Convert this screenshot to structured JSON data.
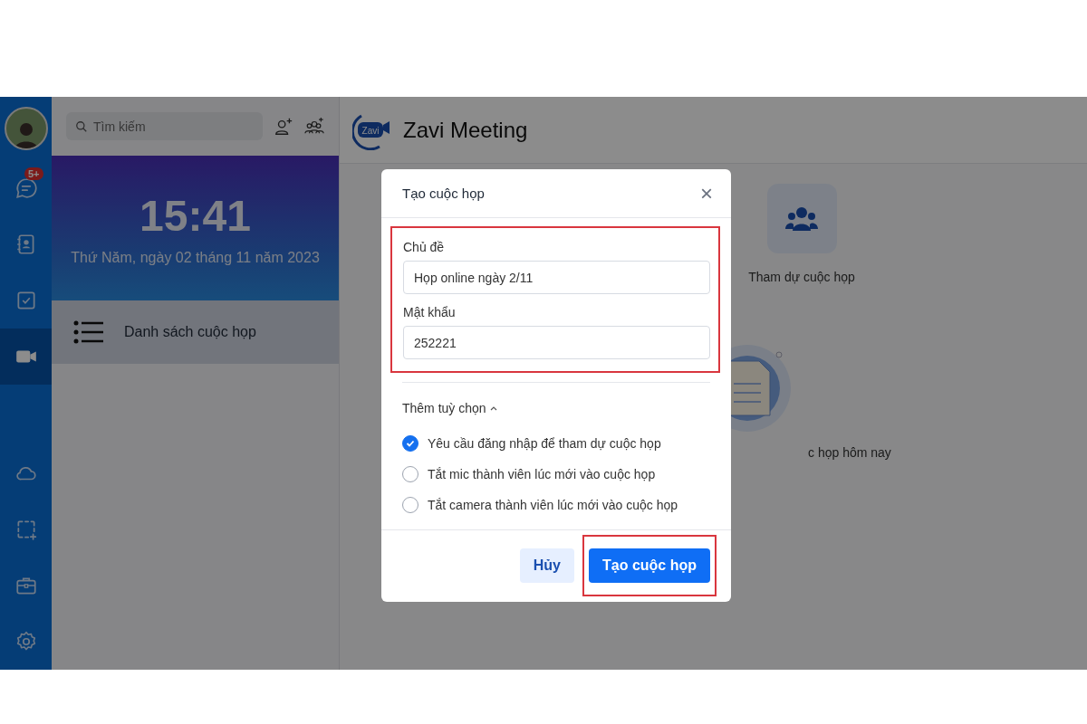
{
  "rail": [
    {
      "kind": "avatar",
      "selected": false
    },
    {
      "kind": "chat",
      "selected": false,
      "badge": "5+"
    },
    {
      "kind": "contacts",
      "selected": false
    },
    {
      "kind": "tasks",
      "selected": false
    },
    {
      "kind": "video",
      "selected": true
    },
    {
      "kind": "cloud",
      "selected": false
    },
    {
      "kind": "capture",
      "selected": false
    },
    {
      "kind": "briefcase",
      "selected": false
    },
    {
      "kind": "settings",
      "selected": false
    }
  ],
  "side": {
    "search": {
      "placeholder": "Tìm kiếm"
    },
    "clock": {
      "time": "15:41",
      "date": "Thứ Năm, ngày 02 tháng 11 năm 2023"
    },
    "items": [
      {
        "label": "Danh sách cuộc họp",
        "selected": true
      }
    ]
  },
  "main": {
    "logo_text": "Zavi",
    "title": "Zavi Meeting",
    "tiles": [
      {
        "label": "Tham dự cuộc họp"
      }
    ],
    "today_label": "c họp hôm nay"
  },
  "dialog": {
    "title": "Tạo cuộc họp",
    "close": "×",
    "fields": [
      {
        "label": "Chủ đề",
        "value": "Họp online ngày 2/11"
      },
      {
        "label": "Mật khẩu",
        "value": "252221"
      }
    ],
    "more_options": {
      "label": "Thêm tuỳ chọn",
      "expanded": true
    },
    "options": [
      {
        "label": "Yêu cầu đăng nhập để tham dự cuộc họp",
        "checked": true
      },
      {
        "label": "Tắt mic thành viên lúc mới vào cuộc họp",
        "checked": false
      },
      {
        "label": "Tắt camera thành viên lúc mới vào cuộc họp",
        "checked": false
      }
    ],
    "buttons": [
      {
        "label": "Hủy",
        "kind": "secondary"
      },
      {
        "label": "Tạo cuộc họp",
        "kind": "primary",
        "highlighted": true
      }
    ]
  }
}
